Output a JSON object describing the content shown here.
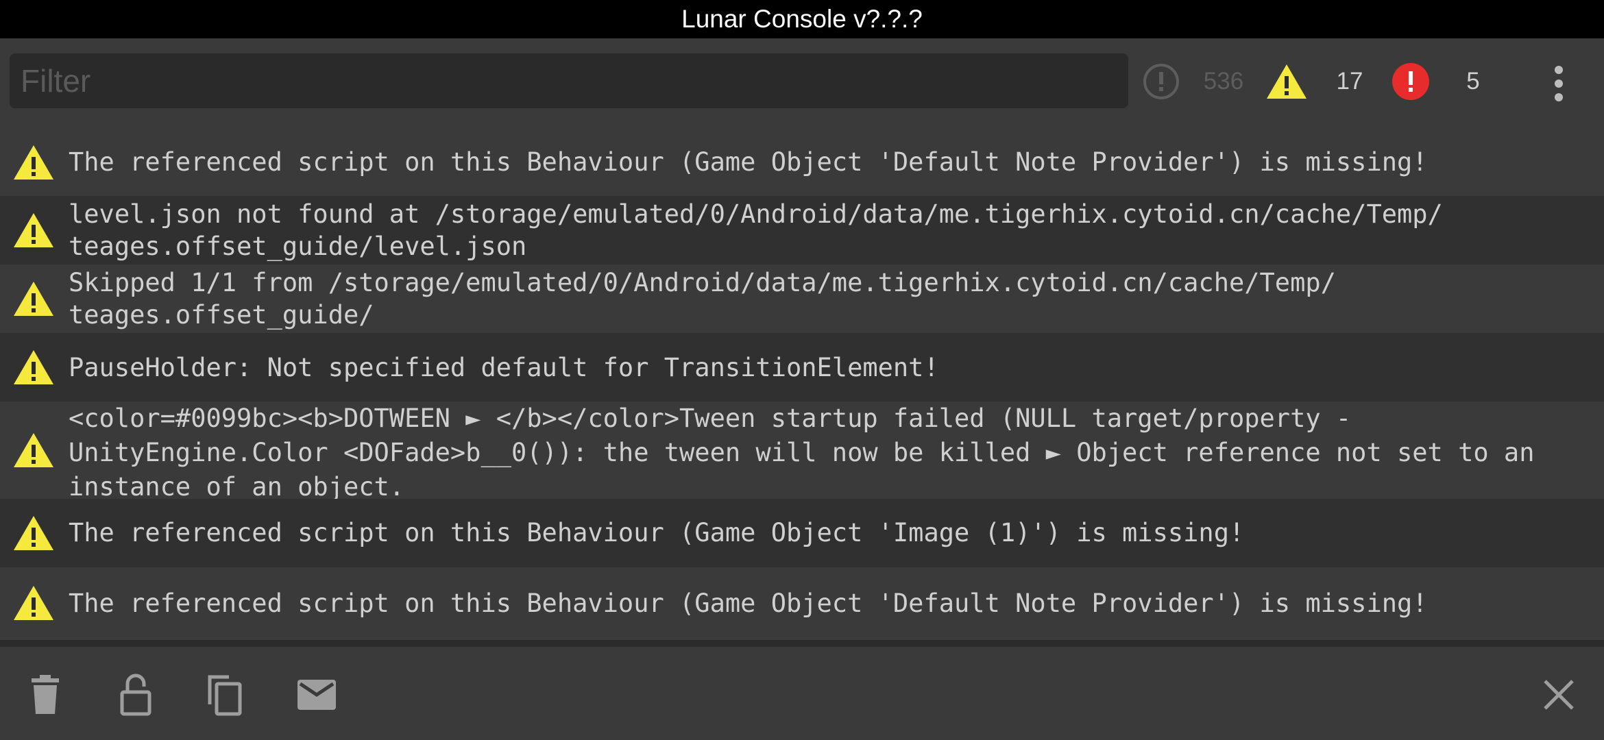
{
  "window": {
    "title": "Lunar Console v?.?.?"
  },
  "filter": {
    "placeholder": "Filter",
    "value": ""
  },
  "counters": {
    "log": {
      "icon": "info-circle-icon",
      "count": "536",
      "color": "#5d5d5d"
    },
    "warning": {
      "icon": "warning-icon",
      "count": "17",
      "color": "#f5e93d"
    },
    "error": {
      "icon": "error-icon",
      "count": "5",
      "color": "#e82b2b"
    }
  },
  "menu": {
    "icon": "kebab-menu-icon"
  },
  "entries": [
    {
      "type": "warning",
      "text": "The referenced script on this Behaviour (Game Object 'Default Note Provider') is missing!"
    },
    {
      "type": "warning",
      "text": "level.json not found at /storage/emulated/0/Android/data/me.tigerhix.cytoid.cn/cache/Temp/\nteages.offset_guide/level.json"
    },
    {
      "type": "warning",
      "text": "Skipped 1/1 from /storage/emulated/0/Android/data/me.tigerhix.cytoid.cn/cache/Temp/\nteages.offset_guide/"
    },
    {
      "type": "warning",
      "text": "PauseHolder: Not specified default for TransitionElement!"
    },
    {
      "type": "warning",
      "text": "<color=#0099bc><b>DOTWEEN ► </b></color>Tween startup failed (NULL target/property -\nUnityEngine.Color <DOFade>b__0()): the tween will now be killed ► Object reference not set to an\ninstance of an object."
    },
    {
      "type": "warning",
      "text": "The referenced script on this Behaviour (Game Object 'Image (1)') is missing!"
    },
    {
      "type": "warning",
      "text": "The referenced script on this Behaviour (Game Object 'Default Note Provider') is missing!"
    }
  ],
  "bottom_actions": {
    "clear": "trash-icon",
    "lock": "unlock-icon",
    "copy": "copy-icon",
    "email": "email-icon",
    "close": "close-icon"
  },
  "colors": {
    "warning": "#f5e93d",
    "error": "#e82b2b",
    "row_light": "#3a3a3a",
    "row_dark": "#303030",
    "text": "#d0d0d0"
  }
}
